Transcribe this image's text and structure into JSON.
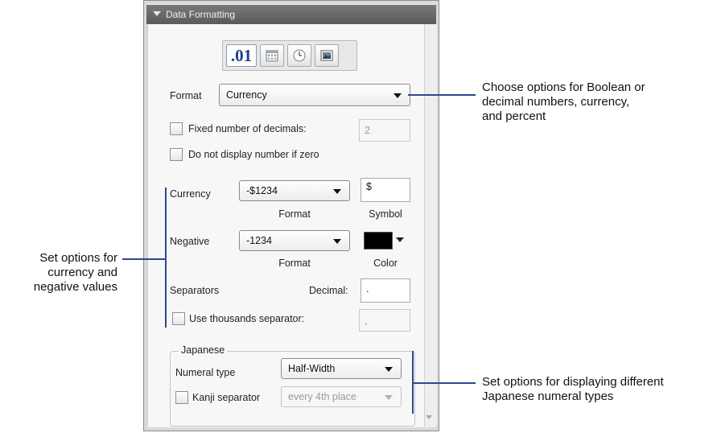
{
  "panel": {
    "title": "Data Formatting",
    "type_buttons": [
      {
        "label": ".01",
        "icon": "decimal-number-icon",
        "active": true
      },
      {
        "label": "",
        "icon": "calendar-icon",
        "active": false
      },
      {
        "label": "",
        "icon": "clock-icon",
        "active": false
      },
      {
        "label": "",
        "icon": "image-icon",
        "active": false
      }
    ],
    "format_label": "Format",
    "format_value": "Currency",
    "fixed_decimals_label": "Fixed number of decimals:",
    "fixed_decimals_value": "2",
    "hide_zero_label": "Do not display number if zero",
    "currency_label": "Currency",
    "currency_format_value": "-$1234",
    "currency_symbol_value": "$",
    "format_caption": "Format",
    "symbol_caption": "Symbol",
    "negative_label": "Negative",
    "negative_format_value": "-1234",
    "negative_format_caption": "Format",
    "color_caption": "Color",
    "negative_color": "#000000",
    "separators_label": "Separators",
    "decimal_label": "Decimal:",
    "decimal_value": ".",
    "thousands_label": "Use thousands separator:",
    "thousands_value": ",",
    "japanese": {
      "group_title": "Japanese",
      "numeral_type_label": "Numeral type",
      "numeral_type_value": "Half-Width",
      "kanji_separator_label": "Kanji separator",
      "kanji_separator_value": "every 4th place"
    }
  },
  "annotations": {
    "top_right": [
      "Choose options for Boolean or",
      "decimal numbers, currency,",
      "and percent"
    ],
    "left": [
      "Set options for",
      "currency and",
      "negative values"
    ],
    "bottom_right": [
      "Set options for displaying different",
      "Japanese numeral types"
    ]
  },
  "colors": {
    "header_bg": "#666666",
    "callout_line": "#2b4a8a",
    "active_button_text": "#1a3f8e"
  }
}
